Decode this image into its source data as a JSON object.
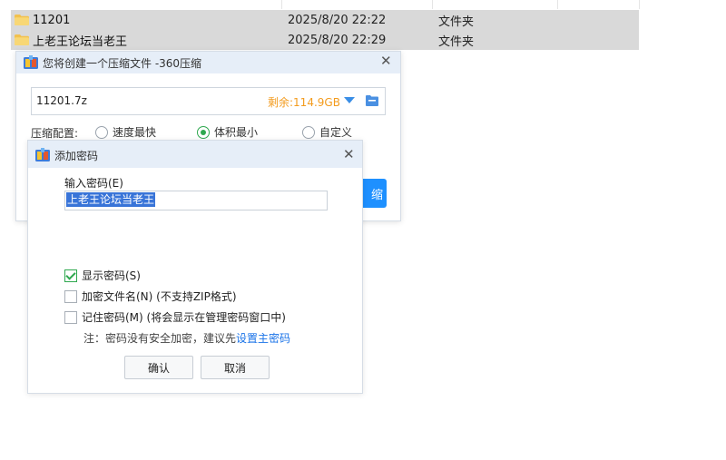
{
  "explorer": {
    "rows": [
      {
        "name": "11201",
        "date": "2025/8/20 22:22",
        "type": "文件夹"
      },
      {
        "name": "上老王论坛当老王",
        "date": "2025/8/20 22:29",
        "type": "文件夹"
      }
    ]
  },
  "zip_dialog": {
    "title": "您将创建一个压缩文件 -360压缩",
    "filename": "11201.7z",
    "free_space": "剩余:114.9GB",
    "config_label": "压缩配置:",
    "options": [
      "速度最快",
      "体积最小",
      "自定义"
    ],
    "selected_option": "体积最小",
    "compress_button_partial": "缩"
  },
  "password_dialog": {
    "title": "添加密码",
    "input_label": "输入密码(E)",
    "password_value": "上老王论坛当老王",
    "show_password": {
      "label": "显示密码(S)",
      "checked": true
    },
    "encrypt_filename": {
      "label": "加密文件名(N) (不支持ZIP格式)",
      "checked": false
    },
    "remember_password": {
      "label": "记住密码(M) (将会显示在管理密码窗口中)",
      "checked": false
    },
    "note_text": "注：密码没有安全加密，建议先",
    "note_link": "设置主密码",
    "ok_label": "确认",
    "cancel_label": "取消"
  },
  "icons": {
    "folder": "folder-icon",
    "app": "360zip-app-icon",
    "close": "close-icon",
    "dropdown": "dropdown-arrow-icon",
    "browse": "browse-folder-icon"
  },
  "colors": {
    "accent": "#1e90ff",
    "free_space": "#f39b1d",
    "check_green": "#2fa84f",
    "selection": "#3874d8",
    "row_selected": "#d9d9d9"
  }
}
